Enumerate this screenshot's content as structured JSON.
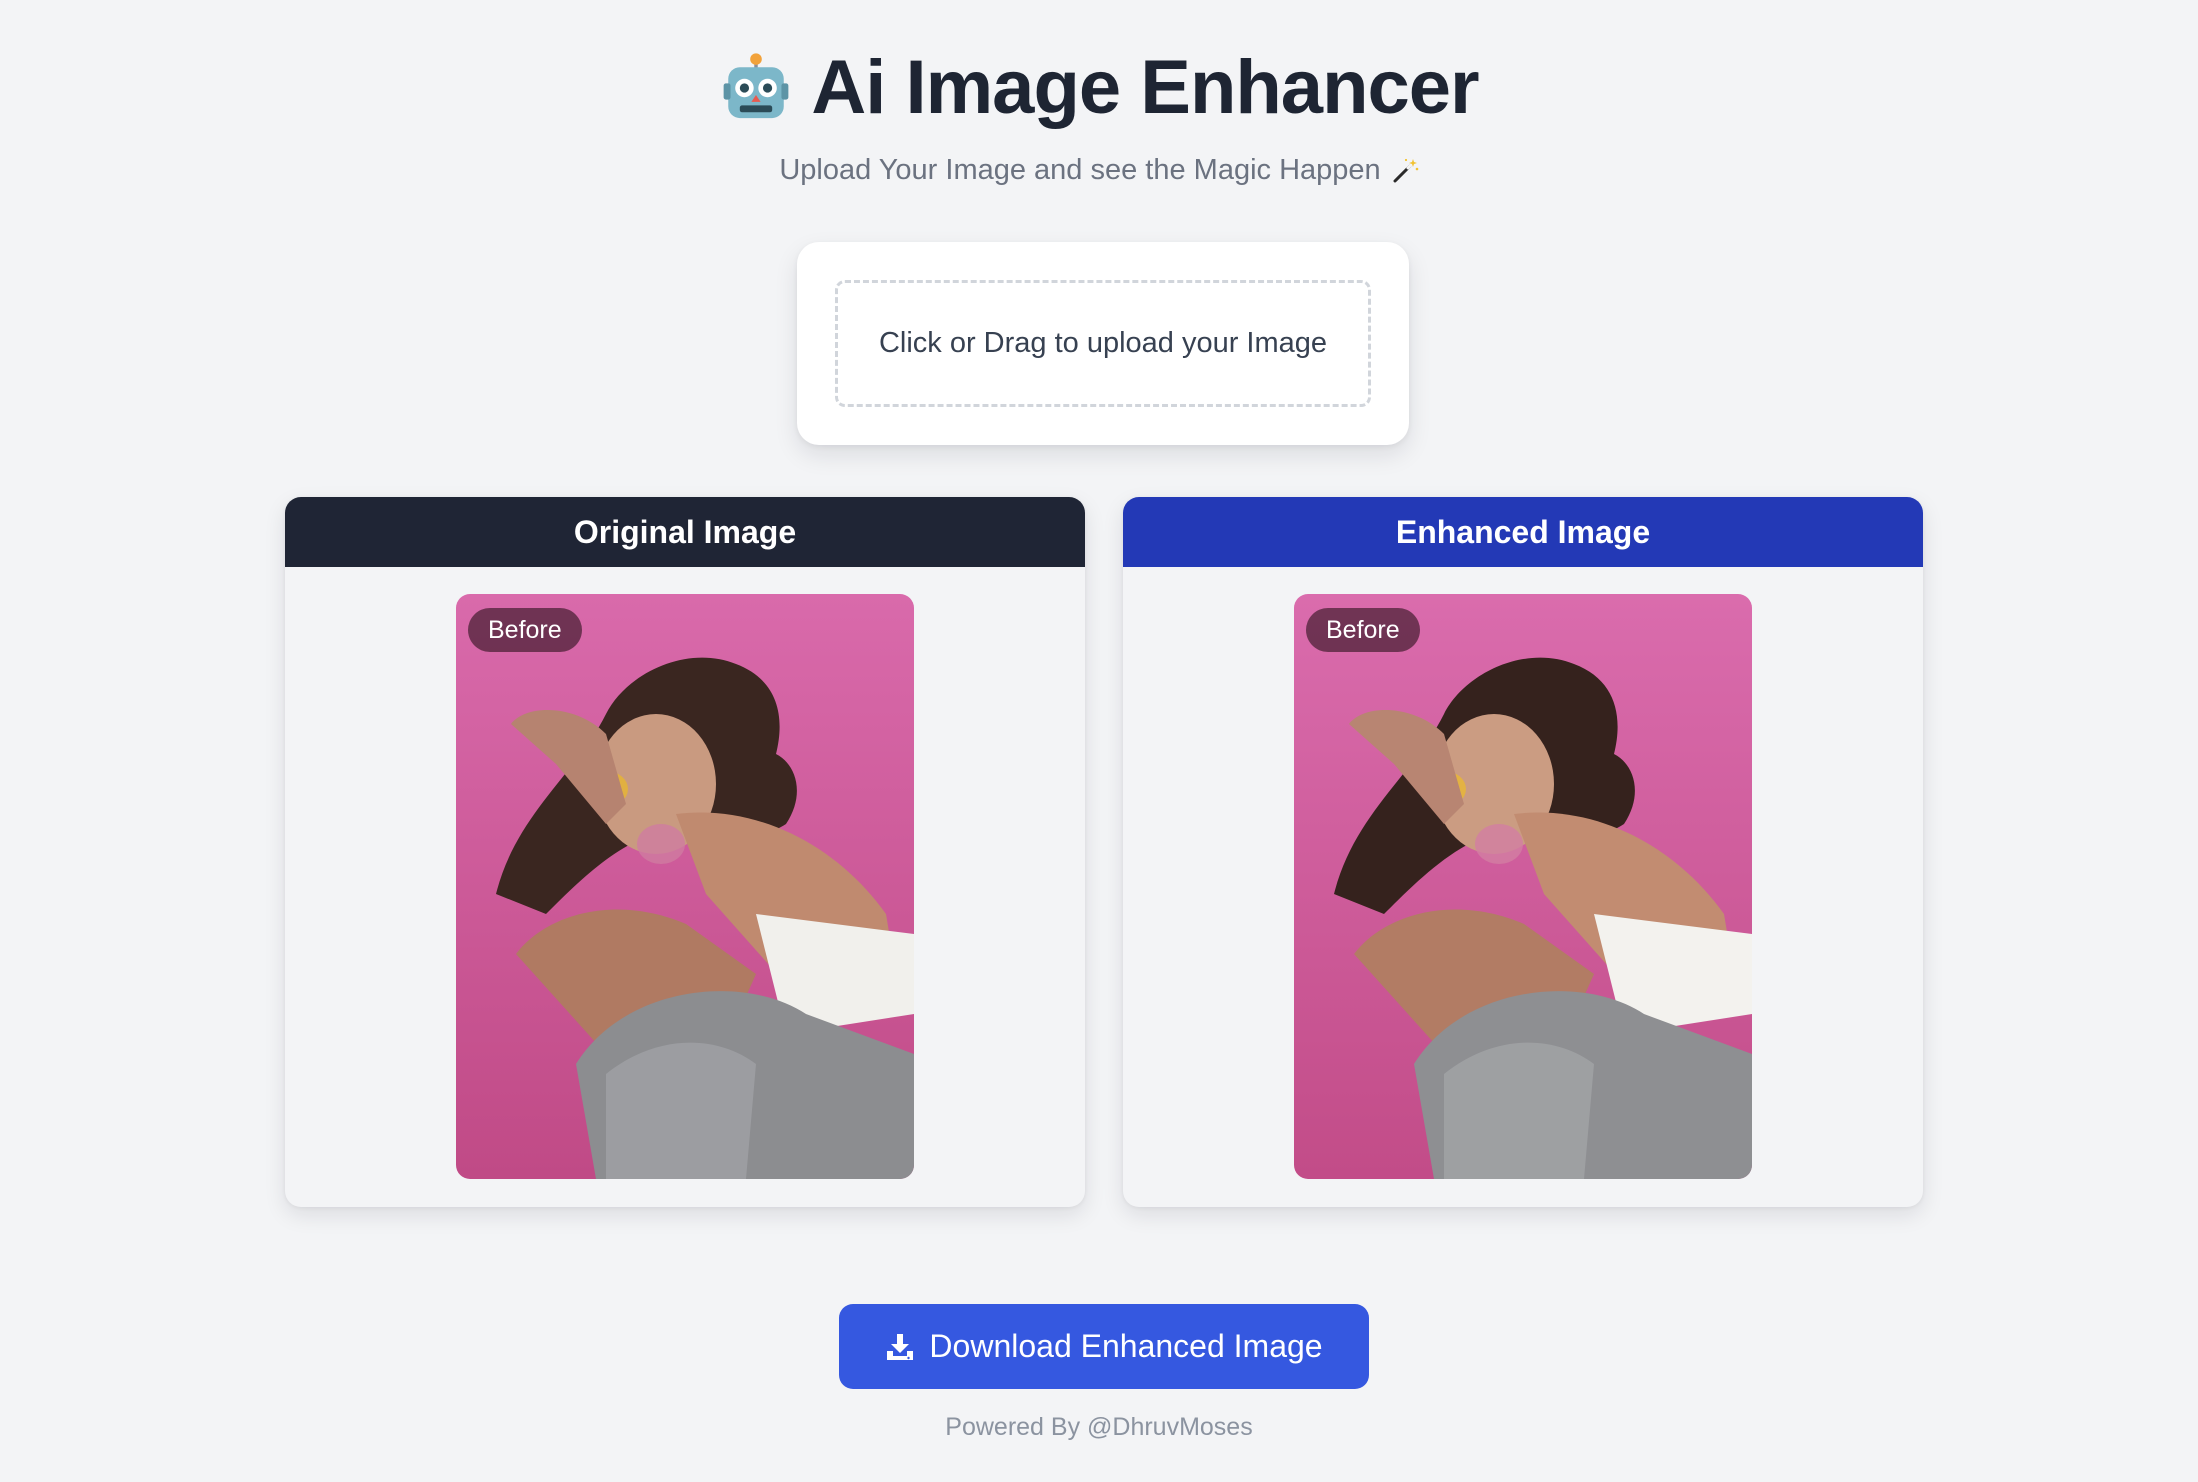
{
  "header": {
    "title": "Ai Image Enhancer",
    "subtitle": "Upload Your Image and see the Magic Happen",
    "title_icon": "robot-face",
    "subtitle_icon": "magic-wand"
  },
  "upload": {
    "prompt": "Click or Drag to upload your Image"
  },
  "panels": {
    "original": {
      "title": "Original Image",
      "badge": "Before"
    },
    "enhanced": {
      "title": "Enhanced Image",
      "badge": "Before"
    }
  },
  "actions": {
    "download_label": "Download Enhanced Image",
    "download_icon": "download-tray"
  },
  "footer": {
    "text": "Powered By @DhruvMoses"
  },
  "colors": {
    "background": "#f3f4f6",
    "original_header": "#1f2535",
    "enhanced_header": "#2339b6",
    "download_button": "#3558e0",
    "photo_background": "#cf5f9f"
  }
}
